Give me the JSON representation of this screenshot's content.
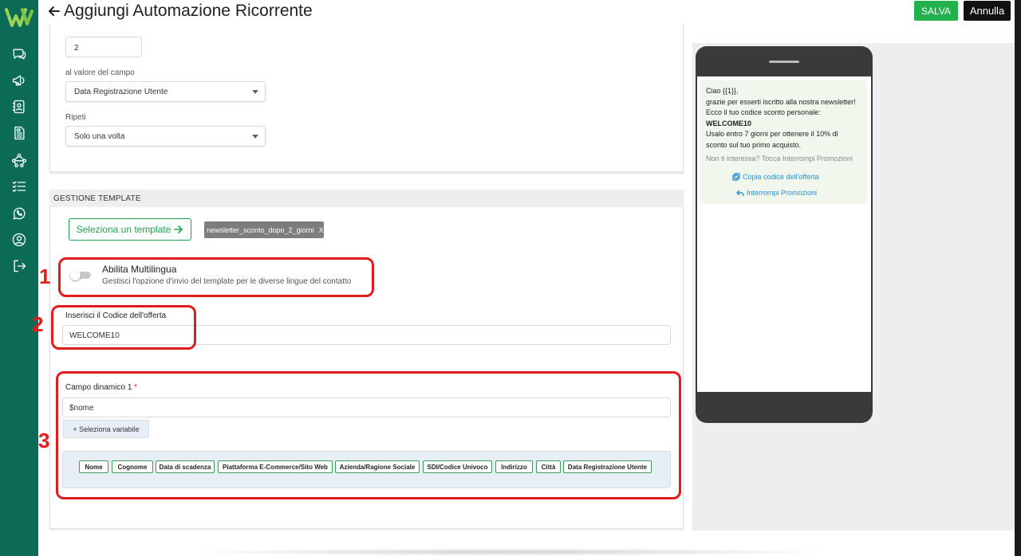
{
  "header": {
    "title": "Aggiungi Automazione Ricorrente",
    "save_label": "SALVA",
    "cancel_label": "Annulla"
  },
  "sidebar": {
    "items": [
      {
        "icon": "chat-icon"
      },
      {
        "icon": "megaphone-icon"
      },
      {
        "icon": "contacts-icon"
      },
      {
        "icon": "document-icon"
      },
      {
        "icon": "workflow-icon"
      },
      {
        "icon": "checklist-icon"
      },
      {
        "icon": "whatsapp-icon"
      },
      {
        "icon": "user-icon"
      },
      {
        "icon": "logout-icon"
      }
    ]
  },
  "schedule": {
    "number_value": "2",
    "field_label": "al valore del campo",
    "field_value": "Data Registrazione Utente",
    "repeat_label": "Ripeti",
    "repeat_value": "Solo una volta"
  },
  "template_section": {
    "header": "GESTIONE TEMPLATE",
    "select_button": "Seleziona un template",
    "selected_chip": "newsletter_sconto_dopo_2_giorni",
    "chip_remove": "X",
    "multilang_title": "Abilita Multilingua",
    "multilang_desc": "Gestisci l'opzione d'invio del template per le diverse lingue del contatto",
    "offer_code_label": "Inserisci il Codice dell'offerta",
    "offer_code_value": "WELCOME10",
    "dynamic_label": "Campo dinamico 1",
    "dynamic_required": "*",
    "dynamic_value": "$nome",
    "select_variable": "+ Seleziona variabile",
    "tags": [
      "Nome",
      "Cognome",
      "Data di scadenza",
      "Piattaforma E-Commerce/Sito Web",
      "Azienda/Ragione Sociale",
      "SDI/Codice Univoco",
      "Indirizzo",
      "Città",
      "Data Registrazione Utente"
    ]
  },
  "annotations": [
    "1",
    "2",
    "3"
  ],
  "preview": {
    "line1": "Ciao {{1}},",
    "line2": "grazie per esserti iscritto alla nostra newsletter!",
    "line3": "Ecco il tuo codice sconto personale:",
    "code": "WELCOME10",
    "line4": "Usalo entro 7 giorni per ottenere il 10% di sconto sul tuo primo acquisto.",
    "footer": "Non ti interessa? Tocca Interrompi Promozioni",
    "action_copy": "Copia codice dell'offerta",
    "action_stop": "Interrompi Promozioni"
  },
  "colors": {
    "sidebar": "#0b6b57",
    "accent_green": "#22b14c",
    "annotation_red": "#e21b1b",
    "link_blue": "#2a8fd6"
  }
}
